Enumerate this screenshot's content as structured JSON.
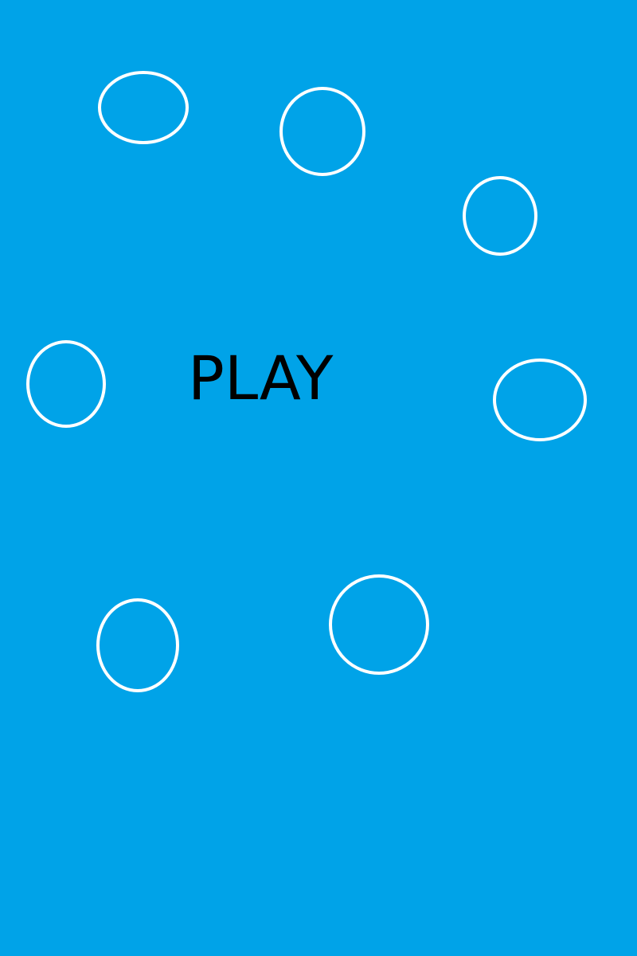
{
  "menu": {
    "play_label": "PLAY"
  },
  "colors": {
    "background": "#00a3e8",
    "bubble_outline": "#ffffff",
    "play_text": "#000000"
  },
  "icons": {
    "bubble": "bubble-icon"
  }
}
